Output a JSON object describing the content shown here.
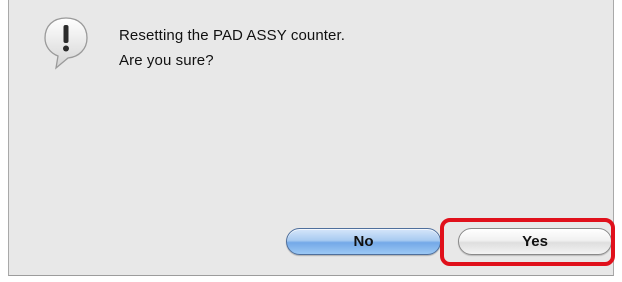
{
  "dialog": {
    "message_line1": "Resetting the PAD ASSY counter.",
    "message_line2": "Are you sure?",
    "icon": "alert-speech-bubble-icon",
    "buttons": {
      "no_label": "No",
      "yes_label": "Yes"
    }
  },
  "annotation": {
    "highlight_target": "yes-button",
    "highlight_color": "#e0101b"
  },
  "colors": {
    "default_button_blue": "#74a9e8",
    "dialog_background": "#e8e8e8"
  }
}
